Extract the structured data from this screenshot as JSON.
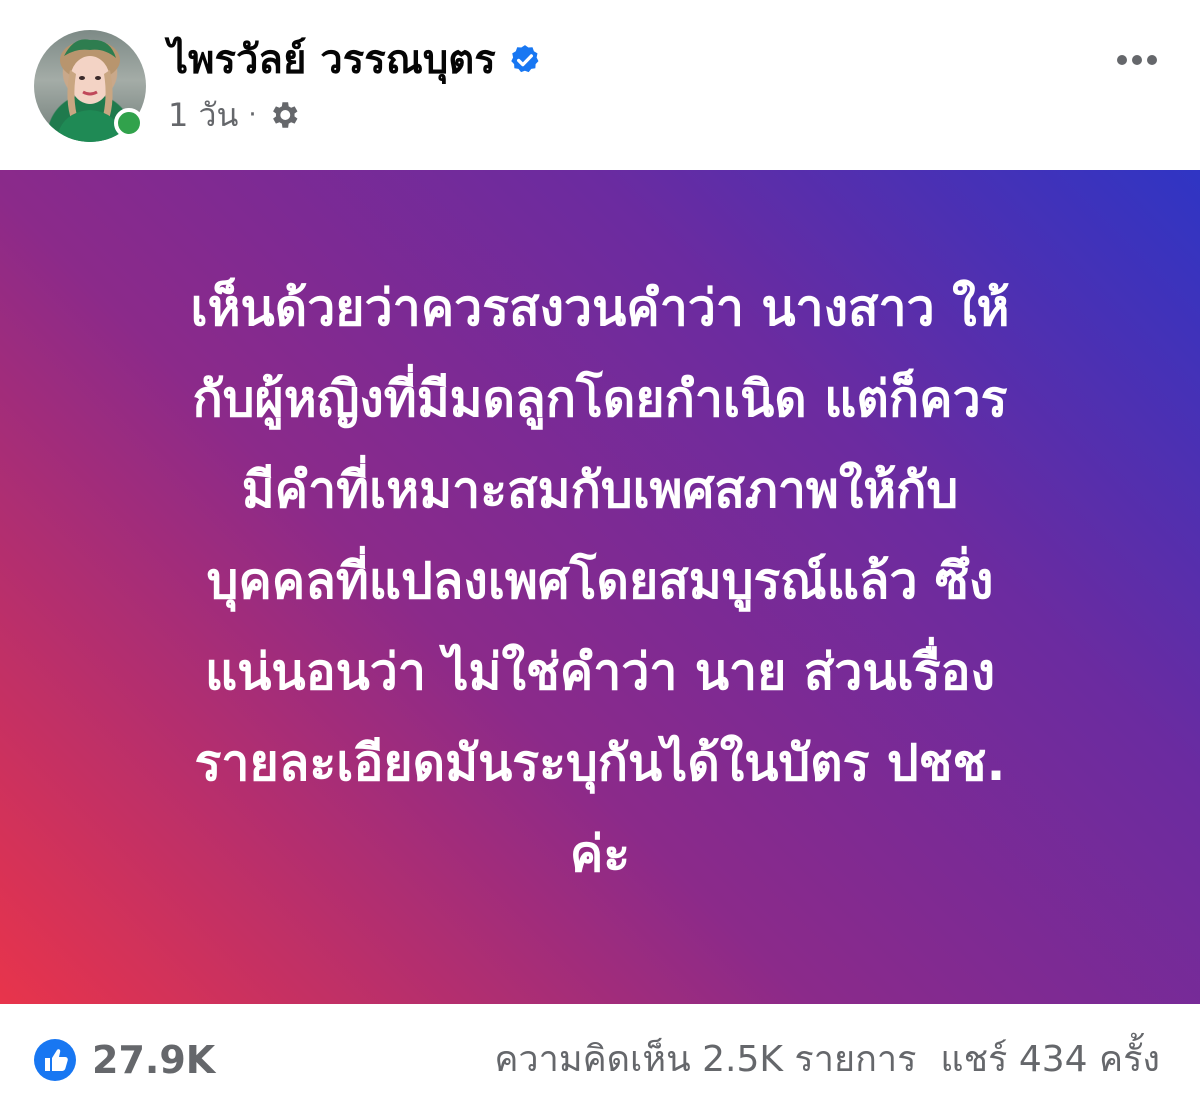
{
  "post": {
    "author_name": "ไพรวัลย์ วรรณบุตร",
    "time": "1 วัน",
    "separator": "·",
    "text": "เห็นด้วยว่าควรสงวนคำว่า นางสาว ให้\nกับผู้หญิงที่มีมดลูกโดยกำเนิด แต่ก็ควร\nมีคำที่เหมาะสมกับเพศสภาพให้กับ\nบุคคลที่แปลงเพศโดยสมบูรณ์แล้ว ซึ่ง\nแน่นอนว่า ไม่ใช่คำว่า นาย ส่วนเรื่อง\nรายละเอียดมันระบุกันได้ในบัตร ปชช.\nค่ะ",
    "background_gradient": [
      "#e8344b",
      "#8b2a8a",
      "#6b2ba0",
      "#2f35c4"
    ]
  },
  "icons": {
    "verified": "verified-badge-icon",
    "audience": "gear-icon",
    "more": "more-options-icon",
    "like": "like-icon"
  },
  "stats": {
    "likes": "27.9K",
    "comments": "ความคิดเห็น 2.5K รายการ",
    "shares": "แชร์ 434 ครั้ง"
  },
  "colors": {
    "verified": "#1877f2",
    "online": "#31a24c",
    "secondary_text": "#65676b"
  }
}
